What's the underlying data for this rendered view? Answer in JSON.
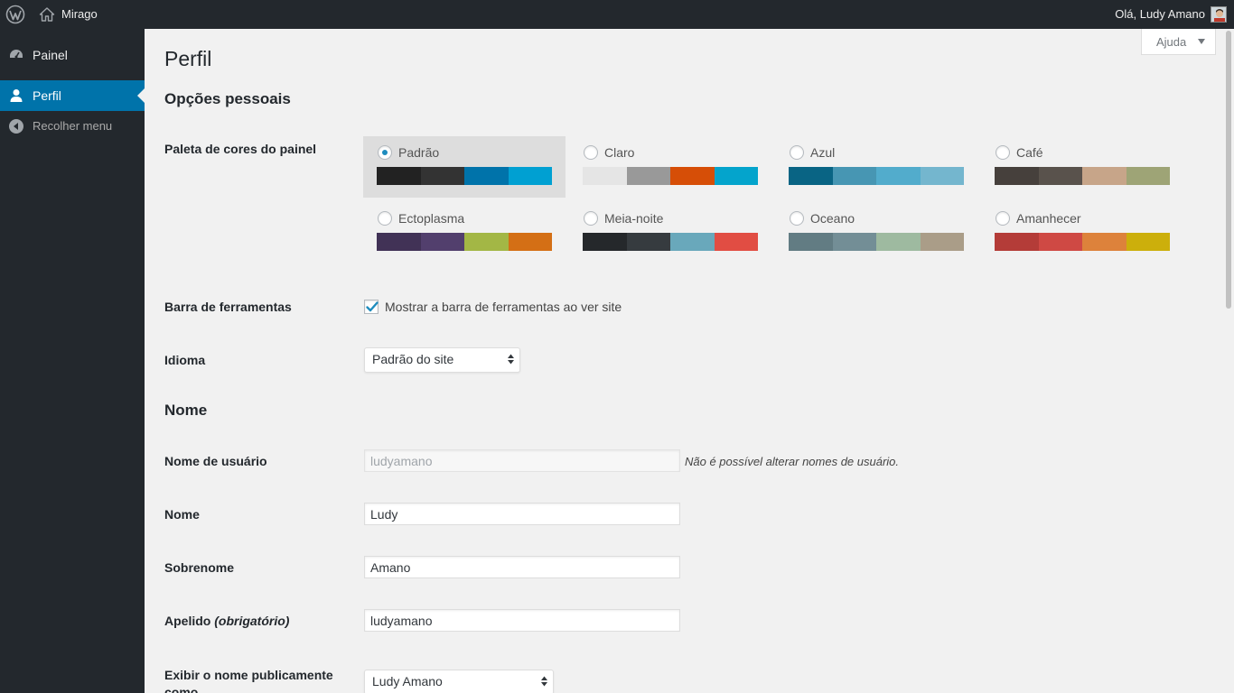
{
  "adminbar": {
    "site_name": "Mirago",
    "greeting": "Olá, Ludy Amano"
  },
  "sidebar": {
    "items": [
      {
        "label": "Painel",
        "icon": "dashboard-icon"
      },
      {
        "label": "Perfil",
        "icon": "user-icon",
        "active": true
      },
      {
        "label": "Recolher menu",
        "icon": "collapse-icon"
      }
    ]
  },
  "help": {
    "label": "Ajuda"
  },
  "page": {
    "title": "Perfil",
    "personal_options_heading": "Opções pessoais",
    "color_scheme_label": "Paleta de cores do painel",
    "color_schemes": [
      {
        "name": "Padrão",
        "selected": true,
        "colors": [
          "#222222",
          "#333333",
          "#0073aa",
          "#00a0d2"
        ]
      },
      {
        "name": "Claro",
        "selected": false,
        "colors": [
          "#e5e5e5",
          "#999999",
          "#d64e07",
          "#04a4cc"
        ]
      },
      {
        "name": "Azul",
        "selected": false,
        "colors": [
          "#096484",
          "#4796b3",
          "#52accc",
          "#74b6ce"
        ]
      },
      {
        "name": "Café",
        "selected": false,
        "colors": [
          "#46403c",
          "#59524c",
          "#c7a589",
          "#9ea476"
        ]
      },
      {
        "name": "Ectoplasma",
        "selected": false,
        "colors": [
          "#413256",
          "#523f6d",
          "#a3b745",
          "#d46f15"
        ]
      },
      {
        "name": "Meia-noite",
        "selected": false,
        "colors": [
          "#25282b",
          "#363b3f",
          "#69a8bb",
          "#e14d43"
        ]
      },
      {
        "name": "Oceano",
        "selected": false,
        "colors": [
          "#627c83",
          "#738e96",
          "#9ebaa0",
          "#aa9d88"
        ]
      },
      {
        "name": "Amanhecer",
        "selected": false,
        "colors": [
          "#b43c38",
          "#cf4944",
          "#dd823b",
          "#ccaf0b"
        ]
      }
    ],
    "toolbar_label": "Barra de ferramentas",
    "toolbar_checkbox_label": "Mostrar a barra de ferramentas ao ver site",
    "toolbar_checked": true,
    "language_label": "Idioma",
    "language_value": "Padrão do site",
    "name_heading": "Nome",
    "username_label": "Nome de usuário",
    "username_value": "ludyamano",
    "username_note": "Não é possível alterar nomes de usuário.",
    "first_name_label": "Nome",
    "first_name_value": "Ludy",
    "last_name_label": "Sobrenome",
    "last_name_value": "Amano",
    "nickname_label": "Apelido",
    "nickname_required": "(obrigatório)",
    "nickname_value": "ludyamano",
    "display_name_label": "Exibir o nome publicamente como",
    "display_name_value": "Ludy Amano"
  }
}
